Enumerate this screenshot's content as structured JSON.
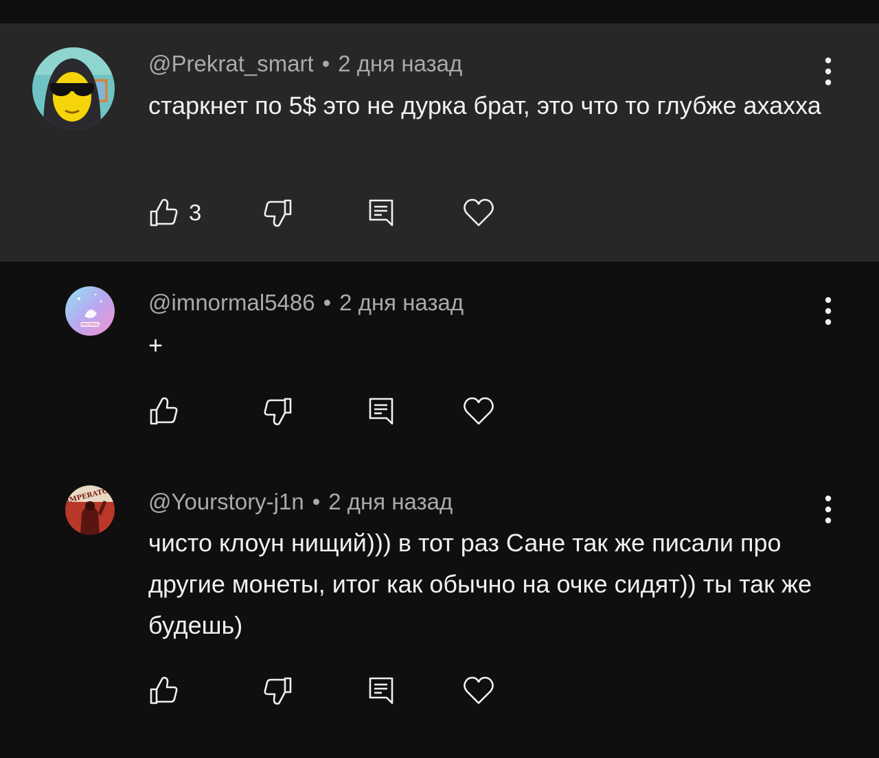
{
  "comments": [
    {
      "author": "@Prekrat_smart",
      "separator": "•",
      "time": "2 дня назад",
      "text": "старкнет по 5$ это не дурка брат, это что то глубже ахахха",
      "likes": "3",
      "highlighted": true
    },
    {
      "author": "@imnormal5486",
      "separator": "•",
      "time": "2 дня назад",
      "text": "+",
      "likes": "",
      "avatar_text": "IMNORMAL"
    },
    {
      "author": "@Yourstory-j1n",
      "separator": "•",
      "time": "2 дня назад",
      "text": "чисто клоун нищий))) в тот раз Сане так же писали про другие монеты, итог как обычно на очке сидят)) ты так же будешь)",
      "likes": "",
      "avatar_text": "IMPERATOR"
    }
  ],
  "icons": {
    "like": "thumbs-up-icon",
    "dislike": "thumbs-down-icon",
    "reply": "reply-comment-icon",
    "heart": "heart-icon",
    "more": "more-vertical-icon"
  },
  "colors": {
    "background": "#0f0f0f",
    "highlight_background": "#272727",
    "meta_text": "#aaaaaa",
    "primary_text": "#f1f1f1"
  }
}
